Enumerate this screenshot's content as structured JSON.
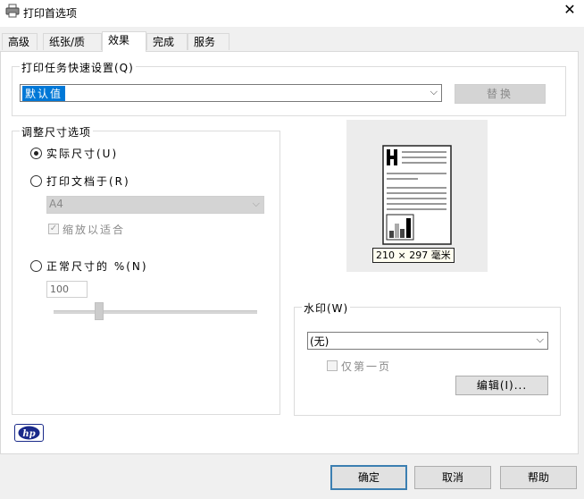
{
  "window": {
    "title": "打印首选项",
    "close_glyph": "✕"
  },
  "tabs": [
    {
      "label": "高级"
    },
    {
      "label": "纸张/质量"
    },
    {
      "label": "效果",
      "active": true
    },
    {
      "label": "完成"
    },
    {
      "label": "服务"
    }
  ],
  "quick_settings": {
    "legend": "打印任务快速设置(Q)",
    "selected": "默认值",
    "replace_button": "替换"
  },
  "resize": {
    "legend": "调整尺寸选项",
    "actual_size": "实际尺寸(U)",
    "print_doc_on": "打印文档于(R)",
    "paper_selected": "A4",
    "fit_to": "缩放以适合",
    "percent_normal": "正常尺寸的 %(N)",
    "percent_value": "100",
    "selected_option": "actual_size",
    "slider_fraction": 0.21
  },
  "preview": {
    "size_label": "210 × 297 毫米"
  },
  "watermark": {
    "legend": "水印(W)",
    "selected": "(无)",
    "first_page_only": "仅第一页",
    "edit_button": "编辑(I)..."
  },
  "buttons": {
    "ok": "确定",
    "cancel": "取消",
    "help": "帮助"
  },
  "brand": {
    "logo_text": "hp",
    "logo_color": "#1a2a8a"
  },
  "colors": {
    "selection": "#0078d7",
    "default_button_border": "#3c7fb1"
  }
}
